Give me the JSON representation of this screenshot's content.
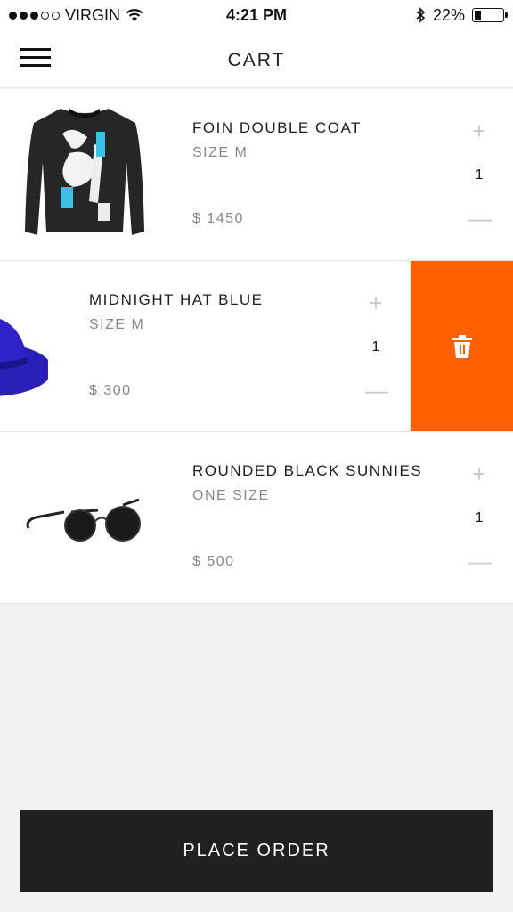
{
  "status_bar": {
    "carrier": "VIRGIN",
    "time": "4:21 PM",
    "battery": "22%",
    "battery_level": 0.22,
    "signal_bars_filled": 3,
    "signal_bars_total": 5,
    "icons": [
      "wifi-icon",
      "bluetooth-icon",
      "battery-icon"
    ]
  },
  "header": {
    "title": "CART",
    "menu_icon": "hamburger-menu-icon"
  },
  "cart": {
    "items": [
      {
        "name": "FOIN DOUBLE COAT",
        "size": "SIZE M",
        "price": "$ 1450",
        "quantity": "1",
        "image": "black-sweater-image"
      },
      {
        "name": "MIDNIGHT HAT BLUE",
        "size": "SIZE M",
        "price": "$ 300",
        "quantity": "1",
        "image": "blue-hat-image",
        "swiped_open": true
      },
      {
        "name": "ROUNDED BLACK SUNNIES",
        "size": "ONE SIZE",
        "price": "$ 500",
        "quantity": "1",
        "image": "sunglasses-image"
      }
    ],
    "plus_symbol": "+",
    "minus_symbol": "—",
    "delete_icon": "trash-icon"
  },
  "footer": {
    "place_order_label": "PLACE ORDER"
  },
  "colors": {
    "accent": "#ff6100",
    "button_dark": "#202020",
    "background": "#f2f2f2"
  }
}
